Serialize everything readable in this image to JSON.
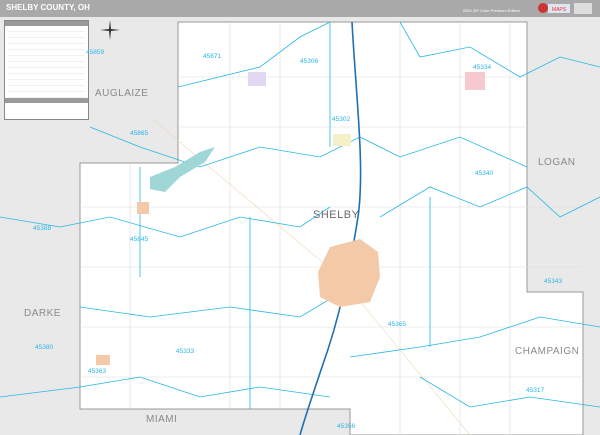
{
  "header": {
    "title": "SHELBY COUNTY, OH",
    "edition": "2026 ZIP Code Premium Edition"
  },
  "colors": {
    "title_bar": "#a9a9a9",
    "county_fill": "#ffffff",
    "outside_fill": "#e9e9e9",
    "zip_boundary": "#29b6e6",
    "interstate": "#1f6fb5",
    "city_fill": "#f3c9a8",
    "water": "#9fd6d6"
  },
  "counties": {
    "auglaize": "AUGLAIZE",
    "logan": "LOGAN",
    "shelby": "SHELBY",
    "darke": "DARKE",
    "champaign": "CHAMPAIGN",
    "miami": "MIAMI"
  },
  "zips": [
    "45859",
    "45871",
    "45306",
    "45334",
    "45302",
    "45865",
    "45340",
    "45388",
    "45845",
    "45343",
    "45365",
    "45380",
    "45333",
    "45363",
    "45317",
    "45356"
  ],
  "legend": {
    "icons": [
      "compass-icon"
    ]
  }
}
